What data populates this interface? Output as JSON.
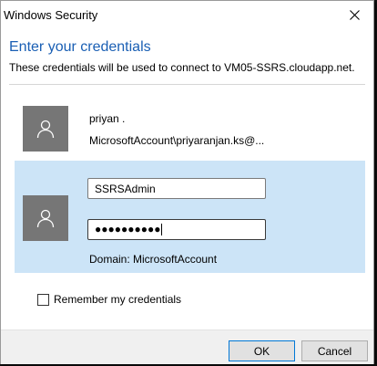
{
  "window": {
    "title": "Windows Security"
  },
  "dialog": {
    "heading": "Enter your credentials",
    "subheading": "These credentials will be used to connect to VM05-SSRS.cloudapp.net."
  },
  "accounts": [
    {
      "name": "priyan .",
      "identifier": "MicrosoftAccount\\priyaranjan.ks@..."
    }
  ],
  "selected_account": {
    "username_value": "SSRSAdmin",
    "password_mask": "●●●●●●●●●●",
    "domain": "Domain: MicrosoftAccount"
  },
  "remember": {
    "label": "Remember my credentials",
    "checked": false
  },
  "buttons": {
    "ok_label": "OK",
    "cancel_label": "Cancel"
  },
  "colors": {
    "accent": "#1a5fb4",
    "selection": "#cce4f7",
    "avatar": "#767676"
  },
  "icons": {
    "close": "close-icon",
    "user": "user-icon"
  }
}
